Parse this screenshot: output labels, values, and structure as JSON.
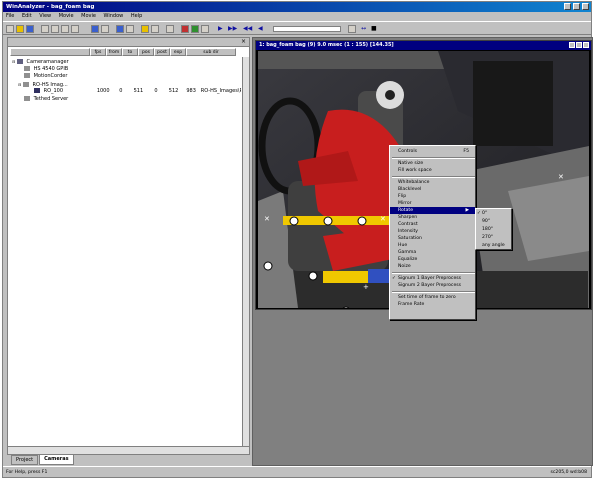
{
  "window": {
    "title": "WinAnalyzer - bag_foam bag"
  },
  "menu": [
    "File",
    "Edit",
    "View",
    "Movie",
    "Movie",
    "Window",
    "Help"
  ],
  "left_panel": {
    "columns": [
      "fps",
      "from",
      "to",
      "pos",
      "post",
      "exp",
      "sub dir"
    ],
    "tree": [
      {
        "label": "Cameramanager",
        "indent": 0
      },
      {
        "label": "HS 4540 GPIB",
        "indent": 1
      },
      {
        "label": "MotionCorder",
        "indent": 1
      },
      {
        "label": "RO-HS Imag...",
        "indent": 1
      },
      {
        "label": "RO_100",
        "indent": 2,
        "values": [
          "1000",
          "0",
          "511",
          "0",
          "512",
          "983",
          "RO-HS_Images\\RO_1C"
        ]
      },
      {
        "label": "Tethed Server",
        "indent": 1
      }
    ],
    "tabs": [
      "Project",
      "Cameras"
    ]
  },
  "image_window": {
    "title": "1: bag_foam bag (9) 9.0 msec (1 : 155) [144.35]"
  },
  "context_menu": {
    "items": [
      {
        "label": "Controls",
        "shortcut": "F5",
        "type": "item"
      },
      {
        "type": "sep"
      },
      {
        "label": "Native size",
        "type": "item"
      },
      {
        "label": "Fill work space",
        "type": "item"
      },
      {
        "type": "sep"
      },
      {
        "label": "Whitebalance",
        "type": "item"
      },
      {
        "label": "Blacklevel",
        "type": "item"
      },
      {
        "label": "Flip",
        "type": "item"
      },
      {
        "label": "Mirror",
        "type": "item"
      },
      {
        "label": "Rotate",
        "type": "item",
        "selected": true,
        "submenu": true
      },
      {
        "label": "Sharpen",
        "type": "item"
      },
      {
        "label": "Contrast",
        "type": "item"
      },
      {
        "label": "Intensity",
        "type": "item"
      },
      {
        "label": "Saturation",
        "type": "item"
      },
      {
        "label": "Hue",
        "type": "item"
      },
      {
        "label": "Gamma",
        "type": "item"
      },
      {
        "label": "Equalize",
        "type": "item"
      },
      {
        "label": "Noize",
        "type": "item"
      },
      {
        "type": "sep"
      },
      {
        "label": "Signum 1 Bayer Preprocess",
        "type": "item",
        "checked": true
      },
      {
        "label": "Signum 2 Bayer Preprocess",
        "type": "item"
      },
      {
        "type": "sep"
      },
      {
        "label": "Set time of frame to zero",
        "type": "item"
      },
      {
        "label": "Frame Rate",
        "type": "item"
      }
    ]
  },
  "rotate_submenu": {
    "items": [
      {
        "label": "0°",
        "checked": true
      },
      {
        "label": "90°"
      },
      {
        "label": "180°"
      },
      {
        "label": "270°"
      },
      {
        "label": "any angle"
      }
    ]
  },
  "status": {
    "left": "For Help, press F1",
    "right": "sc205,0 wd:b08"
  },
  "colors": {
    "titlebar": "#000080",
    "menu_highlight": "#000080",
    "face": "#c0c0c0"
  }
}
